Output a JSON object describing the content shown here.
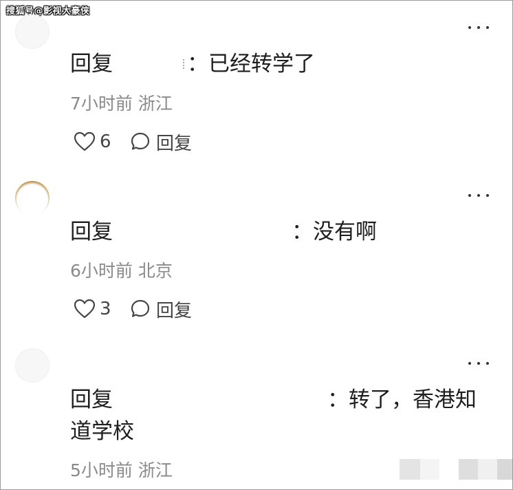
{
  "watermark": "搜狐号@影视大豪侠",
  "comments": [
    {
      "reply_prefix": "回复",
      "reply_text": "：已经转学了",
      "time": "7小时前",
      "location": "浙江",
      "likes": "6",
      "reply_label": "回复"
    },
    {
      "reply_prefix": "回复",
      "reply_text": "：没有啊",
      "time": "6小时前",
      "location": "北京",
      "likes": "3",
      "reply_label": "回复"
    },
    {
      "reply_prefix": "回复",
      "reply_text": "：转了，香港知",
      "reply_text_line2": "道学校",
      "time": "5小时前",
      "location": "浙江"
    }
  ],
  "icons": {
    "like": "heart-outline-icon",
    "reply": "speech-bubble-icon",
    "more": "more-dots-icon"
  },
  "colors": {
    "text": "#1e1e1e",
    "meta": "#8a8a8a",
    "icon": "#444444"
  }
}
